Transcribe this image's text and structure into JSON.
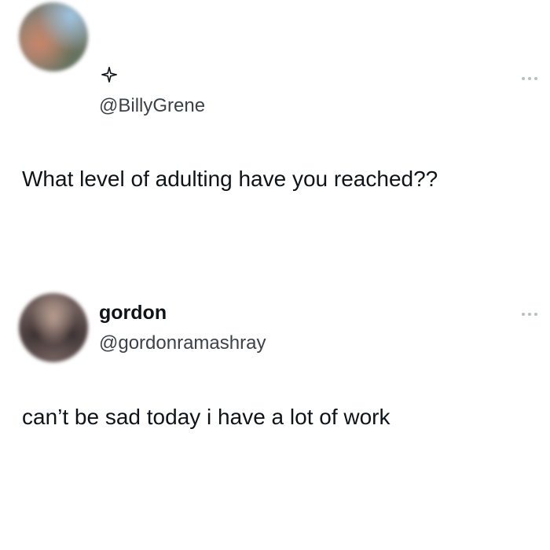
{
  "post1": {
    "handle": "@BillyGrene",
    "text": "What level of adulting have you reached??",
    "verified_icon": "sparkle-badge-icon",
    "more_icon": "more-options-icon"
  },
  "post2": {
    "display_name": "gordon",
    "handle": "@gordonramashray",
    "text": "can’t be sad today i have a lot of work",
    "more_icon": "more-options-icon"
  }
}
